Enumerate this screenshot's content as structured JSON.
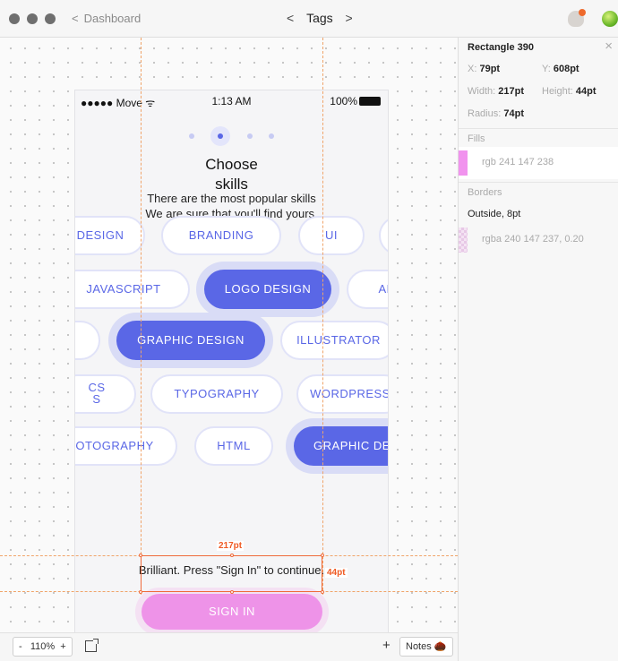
{
  "titlebar": {
    "back_label": "Dashboard",
    "page_title": "Tags",
    "prev_arrow": "<",
    "next_arrow": ">"
  },
  "phone": {
    "carrier": "●●●●● Move ᯤ",
    "time": "1:13 AM",
    "battery": "100%",
    "heading_line1": "Choose",
    "heading_line2": "skills",
    "subtitle_line1": "There are the most popular skills",
    "subtitle_line2": "We are sure that you'll find yours.",
    "tags_row1": [
      "DESIGN",
      "BRANDING",
      "UI",
      ""
    ],
    "tags_row2": [
      "JAVASCRIPT",
      "LOGO DESIGN",
      "AR"
    ],
    "tags_row3": [
      "",
      "GRAPHIC DESIGN",
      "ILLUSTRATOR"
    ],
    "tags_row4_css": [
      "CS",
      "S"
    ],
    "tags_row4": [
      "TYPOGRAPHY",
      "WORDPRESS"
    ],
    "tags_row5": [
      "OTOGRAPHY",
      "HTML",
      "GRAPHIC DE"
    ],
    "hint": "Brilliant. Press \"Sign In\" to continue.",
    "signin_label": "SIGN IN"
  },
  "measurements": {
    "width_label": "217pt",
    "height_label": "44pt"
  },
  "bottombar": {
    "zoom_minus": "-",
    "zoom_level": "110%",
    "zoom_plus": "+",
    "add_label": "+",
    "notes_label": "Notes 🌰"
  },
  "inspector": {
    "title": "Rectangle 390",
    "close": "×",
    "x_label": "X:",
    "x_value": "79pt",
    "y_label": "Y:",
    "y_value": "608pt",
    "width_label": "Width:",
    "width_value": "217pt",
    "height_label": "Height:",
    "height_value": "44pt",
    "radius_label": "Radius:",
    "radius_value": "74pt",
    "fills_header": "Fills",
    "fill_value": "rgb 241 147 238",
    "borders_header": "Borders",
    "border_position": "Outside, 8pt",
    "border_value": "rgba 240 147 237, 0.20"
  },
  "colors": {
    "accent": "#5a67e6",
    "signin_fill": "#f193ee",
    "measure": "#ef5a23"
  }
}
